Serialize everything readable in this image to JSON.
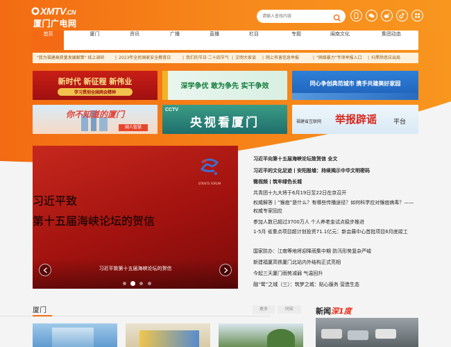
{
  "header": {
    "logo_top": "XMTV",
    "logo_top_suffix": ".CN",
    "logo_bottom": "厦门广电网",
    "search_placeholder": "请输入查找内容",
    "icons": [
      "phone-icon",
      "wechat-icon",
      "weibo-icon",
      "douyin-icon",
      "app-icon"
    ]
  },
  "nav": {
    "items": [
      "首页",
      "厦门",
      "资讯",
      "广播",
      "直播",
      "栏目",
      "专题",
      "闽南文化",
      "集团动态"
    ],
    "active_index": 0
  },
  "ticker": {
    "items": [
      "\"我为福建高质量发展献策\" 线上调研",
      "2023年全民国家安全教育日",
      "我们的节日·二十四节气",
      "文明大家谈",
      "网上有害信息举报",
      "\"网络暴力\"专项举报入口",
      "扫黑除恶应出局"
    ]
  },
  "banners": {
    "b1_line1": "新时代 新征程 新伟业",
    "b1_line2": "学习贯彻全国两会精神",
    "b2": "深学争优 敢为争先 实干争效",
    "b3": "同心争创典范城市 携手共建美好家园",
    "b4_line1": "你不知道的厦门",
    "b4_tag": "闽人智慧",
    "b5_tag": "CCTV",
    "b5": "央视看厦门",
    "b6_prefix": "福建省互联网",
    "b6_main": "举报辟谣",
    "b6_suffix": "平台"
  },
  "slider": {
    "title_line1": "习近平致",
    "title_line2": "第十五届海峡论坛的贺信",
    "caption": "习近平致第十五届海峡论坛的贺信",
    "forum_logo": "STRAITS FORUM",
    "dots": 4,
    "active_dot": 1
  },
  "news": {
    "items": [
      "习近平向第十五届海峡论坛致贺信 全文",
      "习近平的文化足迹丨安阳殷墟：持续揭示中华文明密码",
      "微视频丨筑牢绿色长城",
      "共青团十九大将于6月19日至22日在京召开",
      "权威解答丨“猴痘”是什么？有哪些传播途径？如何科学应对猴痘病毒？——权威专家回应",
      "参加人数已超过3700万人 个人养老金试点稳步推进",
      "1-5月 省重点项目超计划投资71.1亿元：新会展中心首批项目6月底竣工",
      "国家防办：江南等地将迎降雨集中期 防汛形势复杂严峻",
      "新建福厦高铁厦门北站内外结构正式亮相",
      "今起三天厦门雨势减弱 气温回升",
      "融“鹭”之城（三）：筑梦之城：贴心服务 营造生态"
    ]
  },
  "section": {
    "title": "厦门",
    "more": "更多",
    "tag": "同安"
  },
  "side": {
    "title_prefix": "新闻",
    "title_highlight": "深1度"
  },
  "colors": {
    "brand_orange": "#f46a14",
    "slider_red": "#b51a14",
    "gold_text": "#ffe6a7"
  }
}
